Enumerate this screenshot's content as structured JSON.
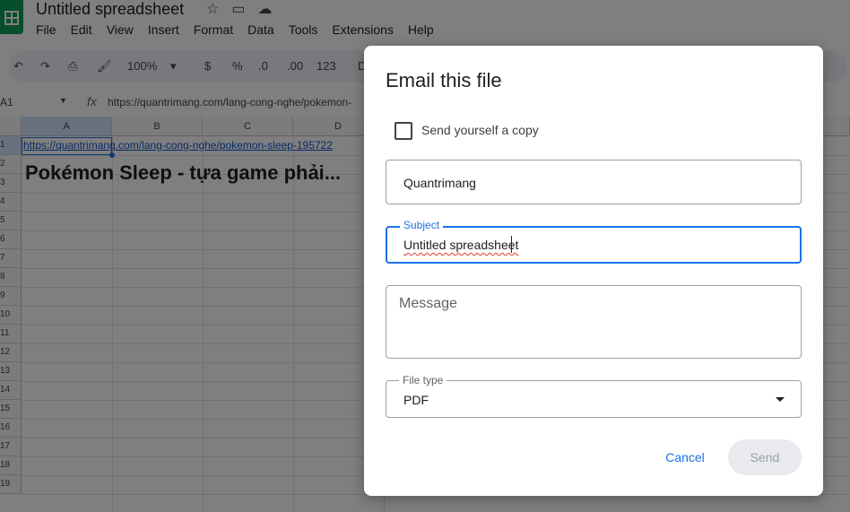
{
  "sheet": {
    "title": "Untitled spreadsheet",
    "menu": [
      "File",
      "Edit",
      "View",
      "Insert",
      "Format",
      "Data",
      "Tools",
      "Extensions",
      "Help"
    ],
    "toolbar": {
      "zoom": "100%",
      "currency": "$",
      "percent": "%",
      "dec_decrease": ".0",
      "dec_increase": ".00",
      "format_123": "123",
      "font_initial": "D"
    },
    "cell_ref": "A1",
    "formula": "https://quantrimang.com/lang-cong-nghe/pokemon-",
    "columns": [
      "A",
      "B",
      "C",
      "D"
    ],
    "rows": [
      "1",
      "2",
      "3",
      "4",
      "5",
      "6",
      "7",
      "8",
      "9",
      "10",
      "11",
      "12",
      "13",
      "14",
      "15",
      "16",
      "17",
      "18",
      "19"
    ],
    "cell_a1": "https://quantrimang.com/lang-cong-nghe/pokemon-sleep-195722",
    "cell_a2": "Pokémon Sleep - tựa game phải..."
  },
  "dialog": {
    "title": "Email this file",
    "send_copy_label": "Send yourself a copy",
    "to_value": "Quantrimang",
    "subject_label": "Subject",
    "subject_value": "Untitled spreadsheet",
    "message_placeholder": "Message",
    "file_type_label": "File type",
    "file_type_value": "PDF",
    "cancel_label": "Cancel",
    "send_label": "Send"
  },
  "colors": {
    "accent": "#1a73e8",
    "overlay": "rgba(0,0,0,0.5)",
    "sheets_green": "#0f9d58"
  }
}
